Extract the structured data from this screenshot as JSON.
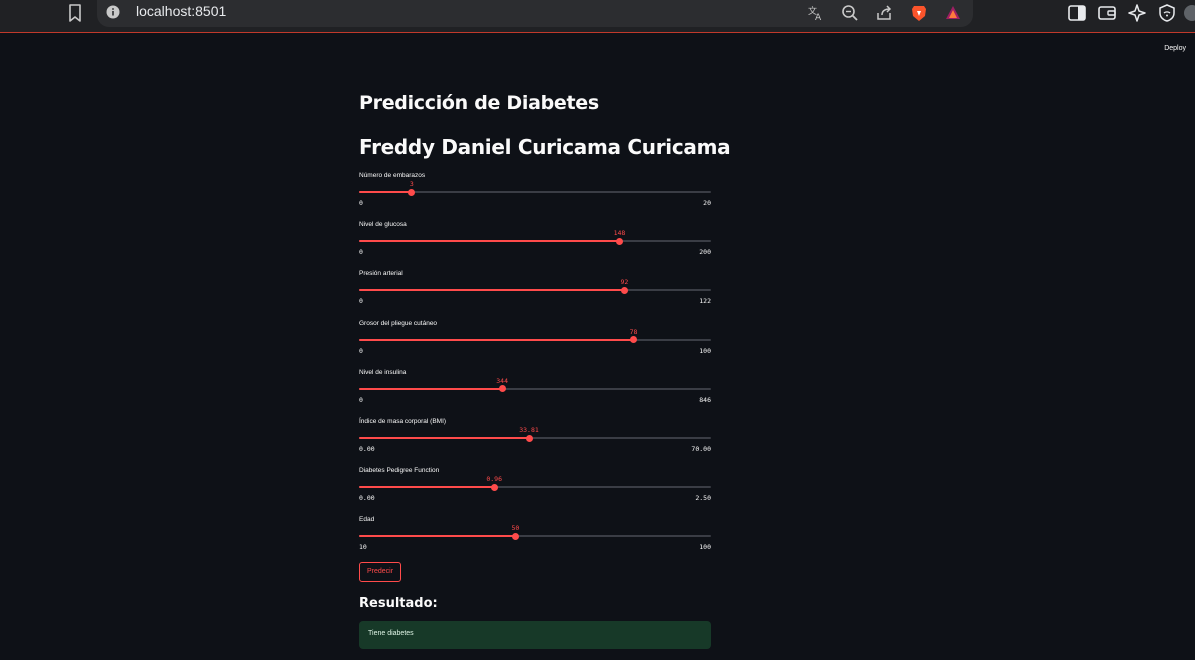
{
  "browser": {
    "url": "localhost:8501"
  },
  "header": {
    "deploy_label": "Deploy"
  },
  "page": {
    "title": "Predicción de Diabetes",
    "author": "Freddy Daniel Curicama Curicama"
  },
  "sliders": [
    {
      "label": "Número de embarazos",
      "value": 3,
      "value_text": "3",
      "min": 0,
      "max": 20,
      "min_text": "0",
      "max_text": "20"
    },
    {
      "label": "Nivel de glucosa",
      "value": 148,
      "value_text": "148",
      "min": 0,
      "max": 200,
      "min_text": "0",
      "max_text": "200"
    },
    {
      "label": "Presión arterial",
      "value": 92,
      "value_text": "92",
      "min": 0,
      "max": 122,
      "min_text": "0",
      "max_text": "122"
    },
    {
      "label": "Grosor del pliegue cutáneo",
      "value": 78,
      "value_text": "78",
      "min": 0,
      "max": 100,
      "min_text": "0",
      "max_text": "100"
    },
    {
      "label": "Nivel de insulina",
      "value": 344,
      "value_text": "344",
      "min": 0,
      "max": 846,
      "min_text": "0",
      "max_text": "846"
    },
    {
      "label": "Índice de masa corporal (BMI)",
      "value": 33.81,
      "value_text": "33.81",
      "min": 0,
      "max": 70,
      "min_text": "0.00",
      "max_text": "70.00"
    },
    {
      "label": "Diabetes Pedigree Function",
      "value": 0.96,
      "value_text": "0.96",
      "min": 0,
      "max": 2.5,
      "min_text": "0.00",
      "max_text": "2.50"
    },
    {
      "label": "Edad",
      "value": 50,
      "value_text": "50",
      "min": 10,
      "max": 100,
      "min_text": "10",
      "max_text": "100"
    }
  ],
  "actions": {
    "predict_label": "Predecir"
  },
  "result": {
    "heading": "Resultado:",
    "message": "Tiene diabetes"
  },
  "colors": {
    "accent": "#ff4b4b",
    "background": "#0e1117",
    "success_bg": "#173928"
  }
}
